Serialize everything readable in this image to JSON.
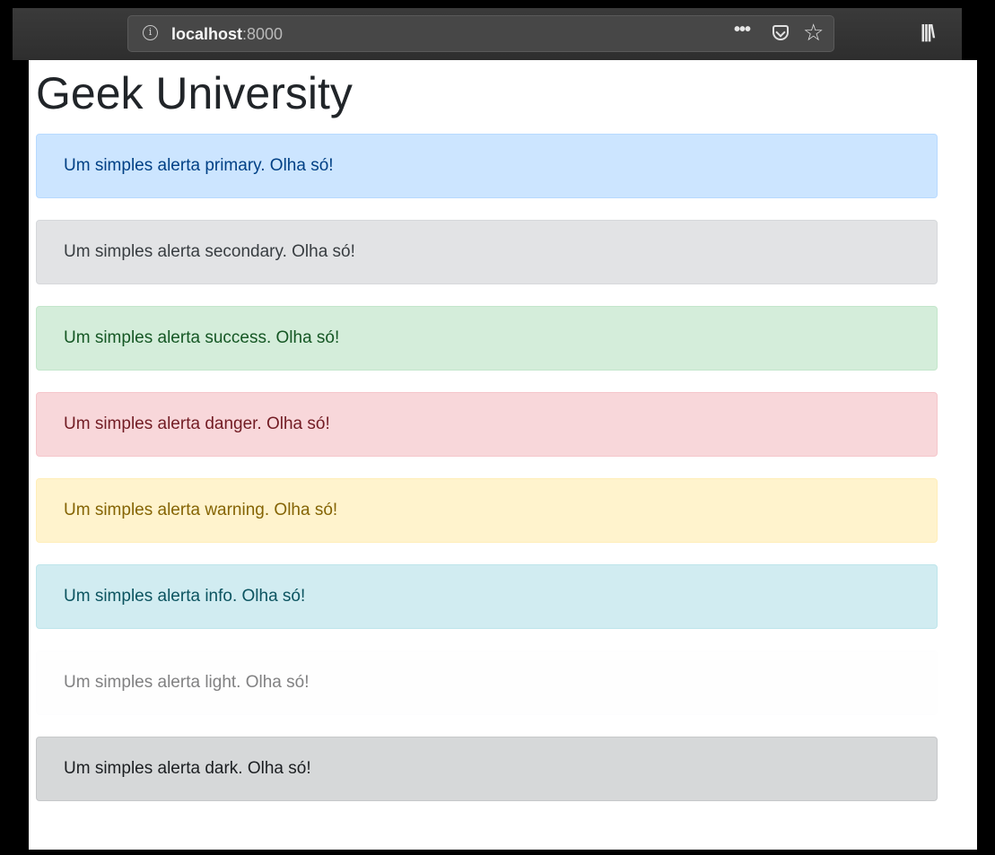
{
  "browser": {
    "url_host": "localhost",
    "url_port": ":8000",
    "icons": {
      "info": "info-icon",
      "more": "more-icon",
      "pocket": "pocket-icon",
      "bookmark": "star-icon",
      "library": "library-icon"
    }
  },
  "page": {
    "title": "Geek University",
    "alerts": [
      {
        "variant": "primary",
        "text": "Um simples alerta primary. Olha só!"
      },
      {
        "variant": "secondary",
        "text": "Um simples alerta secondary. Olha só!"
      },
      {
        "variant": "success",
        "text": "Um simples alerta success. Olha só!"
      },
      {
        "variant": "danger",
        "text": "Um simples alerta danger. Olha só!"
      },
      {
        "variant": "warning",
        "text": "Um simples alerta warning. Olha só!"
      },
      {
        "variant": "info",
        "text": "Um simples alerta info. Olha só!"
      },
      {
        "variant": "light",
        "text": "Um simples alerta light. Olha só!"
      },
      {
        "variant": "dark",
        "text": "Um simples alerta dark. Olha só!"
      }
    ]
  }
}
